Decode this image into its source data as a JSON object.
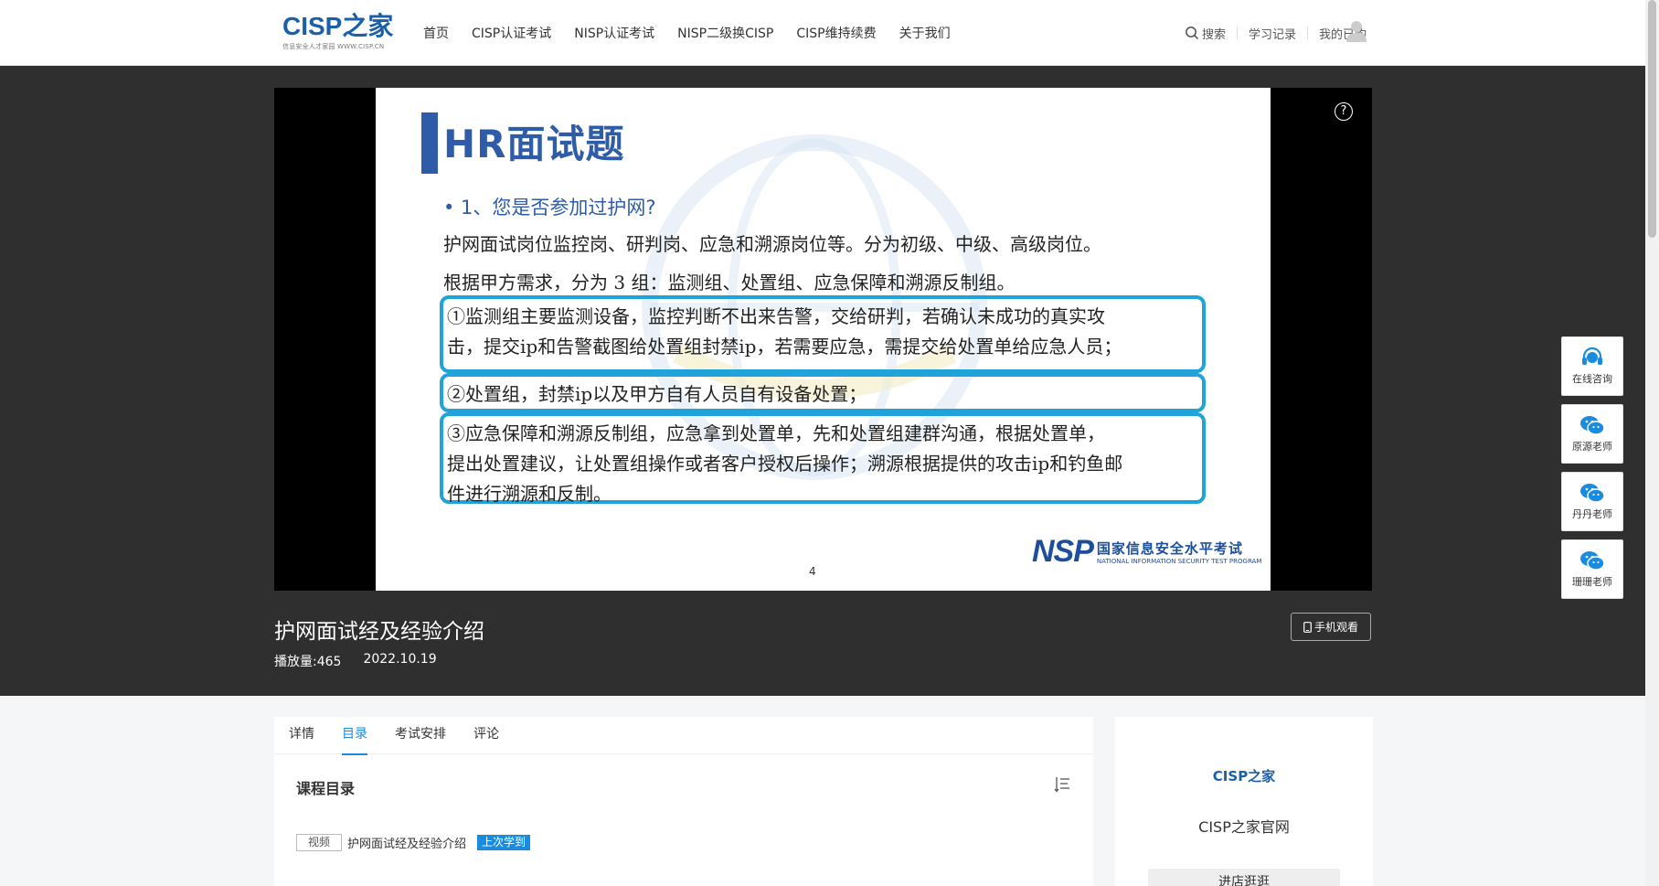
{
  "header": {
    "logo_main": "CISP之家",
    "logo_sub": "信息安全人才家园 WWW.CISP.CN",
    "nav": [
      "首页",
      "CISP认证考试",
      "NISP认证考试",
      "NISP二级换CISP",
      "CISP维持续费",
      "关于我们"
    ],
    "search_label": "搜索",
    "history_label": "学习记录",
    "purchased_label": "我的已购"
  },
  "slide": {
    "title": "HR面试题",
    "question": "• 1、您是否参加过护网?",
    "line1": "护网面试岗位监控岗、研判岗、应急和溯源岗位等。分为初级、中级、高级岗位。",
    "line2": "根据甲方需求，分为 3 组：监测组、处置组、应急保障和溯源反制组。",
    "box1": [
      "①监测组主要监测设备，监控判断不出来告警，交给研判，若确认未成功的真实攻",
      "击，提交ip和告警截图给处置组封禁ip，若需要应急，需提交给处置单给应急人员；"
    ],
    "box2": [
      "②处置组，封禁ip以及甲方自有人员自有设备处置；"
    ],
    "box3": [
      "③应急保障和溯源反制组，应急拿到处置单，先和处置组建群沟通，根据处置单，",
      "提出处置建议，让处置组操作或者客户授权后操作；溯源根据提供的攻击ip和钓鱼邮",
      "件进行溯源和反制。"
    ],
    "page_number": "4",
    "logo_mark": "NSP",
    "logo_cn": "国家信息安全水平考试",
    "logo_en": "NATIONAL INFORMATION SECURITY TEST PROGRAM"
  },
  "video": {
    "help": "?",
    "title": "护网面试经及经验介绍",
    "views": "播放量:465",
    "date": "2022.10.19",
    "mobile_label": "手机观看"
  },
  "floats": [
    "在线咨询",
    "原源老师",
    "丹丹老师",
    "珊珊老师"
  ],
  "tabs": [
    "详情",
    "目录",
    "考试安排",
    "评论"
  ],
  "catalog": {
    "title": "课程目录",
    "item_tag": "视频",
    "item_title": "护网面试经及经验介绍",
    "item_badge": "上次学到"
  },
  "side": {
    "logo": "CISP之家",
    "name": "CISP之家官网",
    "button": "进店逛逛"
  },
  "colors": {
    "brand_blue": "#1a5fa8",
    "accent": "#1a8ce0",
    "dark_bg": "#2f2f2f",
    "box_border": "#1fa3d8"
  }
}
